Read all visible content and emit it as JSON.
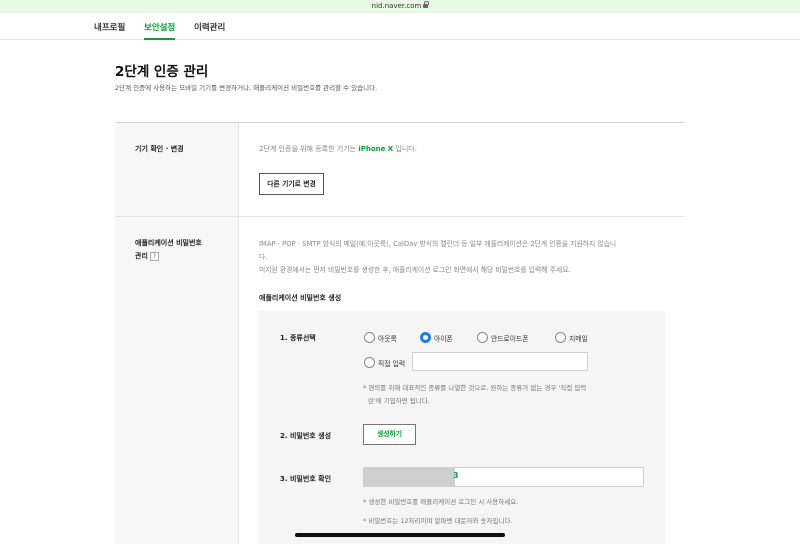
{
  "browser": {
    "url": "nid.naver.com"
  },
  "tabs": [
    {
      "label": "내프로필",
      "active": false
    },
    {
      "label": "보안설정",
      "active": true
    },
    {
      "label": "이력관리",
      "active": false
    }
  ],
  "page": {
    "title": "2단계 인증 관리",
    "description": "2단계 인증에 사용하는 모바일 기기를 변경하거나, 애플리케이션 비밀번호를 관리할 수 있습니다."
  },
  "device_section": {
    "label": "기기 확인 · 변경",
    "text_prefix": "2단계 인증을 위해 등록한 기기는 ",
    "device_name": "iPhone X",
    "text_suffix": " 입니다.",
    "change_button": "다른 기기로 변경"
  },
  "app_password_section": {
    "label_line1": "애플리케이션 비밀번호",
    "label_line2": "관리",
    "help": "?",
    "info_line1": "IMAP · POP · SMTP 방식의 메일(예:아웃룩), CalDav 방식의 캘린더 등 일부 애플리케이션은 2단계 인증을 지원하지 않습니",
    "info_line2": "다.",
    "info_line3": "미지원 환경에서는 먼저 비밀번호를 생성한 후, 애플리케이션 로그인 화면에서 해당 비밀번호를 입력해 주세요.",
    "sub_title": "애플리케이션 비밀번호 생성",
    "step1": {
      "label": "1. 종류선택",
      "options": [
        "아웃룩",
        "아이폰",
        "안드로이드폰",
        "지메일"
      ],
      "selected": "아이폰",
      "direct_input_label": "직접 입력",
      "direct_input_value": "",
      "note_line1": "* 편의를 위해 대표적인 종류를 나열한 것으로, 원하는 종류가 없는 경우 '직접 입력",
      "note_line2": "란'에 기입하면 됩니다."
    },
    "step2": {
      "label": "2. 비밀번호 생성",
      "button": "생성하기"
    },
    "step3": {
      "label": "3. 비밀번호 확인",
      "visible_char": "3",
      "note_line1": "* 생성한 비밀번호를 애플리케이션 로그인 시 사용하세요.",
      "note_line2": "* 비밀번호는 12자리이며 알파벳 대문자와 숫자입니다."
    }
  },
  "colors": {
    "accent_green": "#0aa234",
    "radio_blue": "#1b7ced",
    "url_bar_bg": "#e7f8e3"
  }
}
